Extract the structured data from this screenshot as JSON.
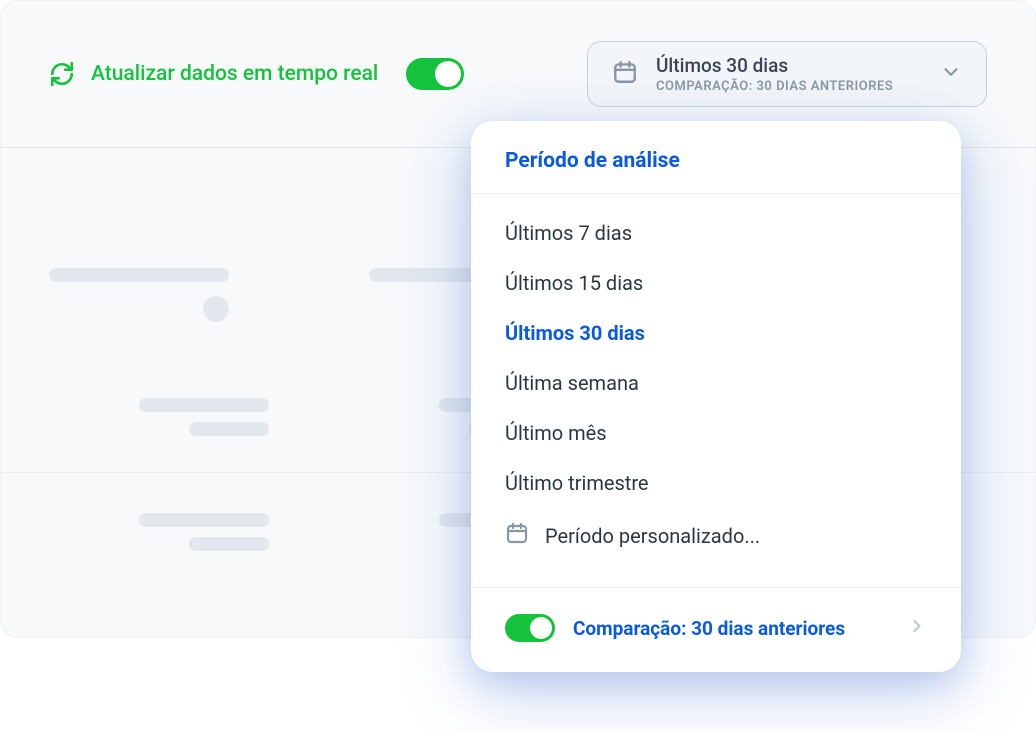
{
  "header": {
    "refresh_label": "Atualizar dados em tempo real",
    "refresh_enabled": true,
    "period_selector": {
      "main": "Últimos 30 dias",
      "comparison": "COMPARAÇÃO: 30 DIAS ANTERIORES"
    }
  },
  "dropdown": {
    "title": "Período de análise",
    "options": [
      {
        "label": "Últimos 7 dias",
        "selected": false
      },
      {
        "label": "Últimos 15 dias",
        "selected": false
      },
      {
        "label": "Últimos 30 dias",
        "selected": true
      },
      {
        "label": "Última semana",
        "selected": false
      },
      {
        "label": "Último mês",
        "selected": false
      },
      {
        "label": "Último trimestre",
        "selected": false
      }
    ],
    "custom_option_label": "Período personalizado...",
    "comparison": {
      "enabled": true,
      "label": "Comparação: 30 dias anteriores"
    }
  }
}
